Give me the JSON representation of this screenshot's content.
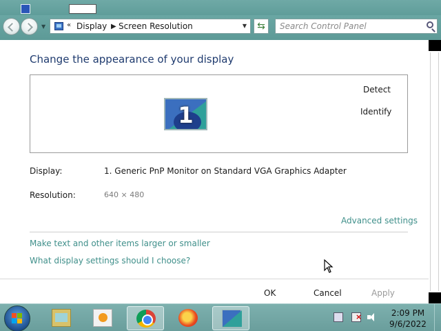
{
  "window": {
    "breadcrumb": [
      "Display",
      "Screen Resolution"
    ],
    "search_placeholder": "Search Control Panel"
  },
  "main": {
    "title": "Change the appearance of your display",
    "monitor_panel": {
      "monitor_number": "1",
      "detect_label": "Detect",
      "identify_label": "Identify"
    },
    "display": {
      "label": "Display:",
      "value": "1. Generic PnP Monitor on Standard VGA Graphics Adapter"
    },
    "resolution": {
      "label": "Resolution:",
      "value": "640 × 480"
    },
    "links": {
      "advanced": "Advanced settings",
      "larger": "Make text and other items larger or smaller",
      "help": "What display settings should I choose?"
    }
  },
  "footer": {
    "ok_label": "OK",
    "cancel_label": "Cancel",
    "apply_label": "Apply"
  },
  "taskbar": {
    "items": [
      {
        "name": "explorer",
        "icon": "file-explorer-icon",
        "active": false
      },
      {
        "name": "media",
        "icon": "media-player-icon",
        "active": false
      },
      {
        "name": "chrome",
        "icon": "chrome-icon",
        "active": true
      },
      {
        "name": "firefox",
        "icon": "firefox-icon",
        "active": false
      },
      {
        "name": "display",
        "icon": "display-settings-icon",
        "active": true
      }
    ],
    "tray_icons": [
      "action-center-flag-icon",
      "network-icon",
      "volume-icon"
    ],
    "clock": {
      "time": "2:09 PM",
      "date": "9/6/2022"
    }
  },
  "colors": {
    "chrome_teal": "#6aa7a4",
    "link": "#3f8f8a",
    "title_text": "#1e3a6e",
    "disabled_text": "#9a9a9a"
  }
}
